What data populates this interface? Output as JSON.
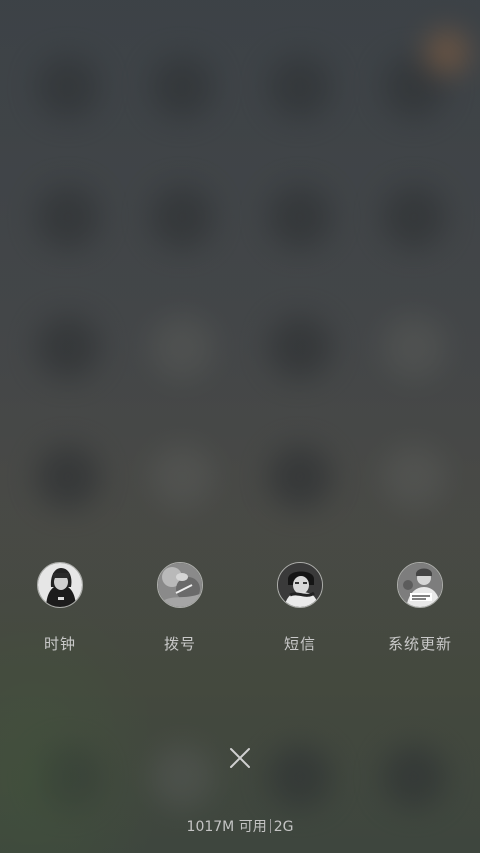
{
  "recent_apps": [
    {
      "label": "时钟",
      "icon": "avatar-hooded-person-icon"
    },
    {
      "label": "拨号",
      "icon": "avatar-blurred-photo-icon"
    },
    {
      "label": "短信",
      "icon": "avatar-scarf-person-icon"
    },
    {
      "label": "系统更新",
      "icon": "avatar-group-photo-icon"
    }
  ],
  "close_icon": "close-icon",
  "memory": {
    "available": "1017M 可用",
    "network": "2G"
  },
  "colors": {
    "label_text": "#c9c9c9",
    "background": "#44474a"
  }
}
